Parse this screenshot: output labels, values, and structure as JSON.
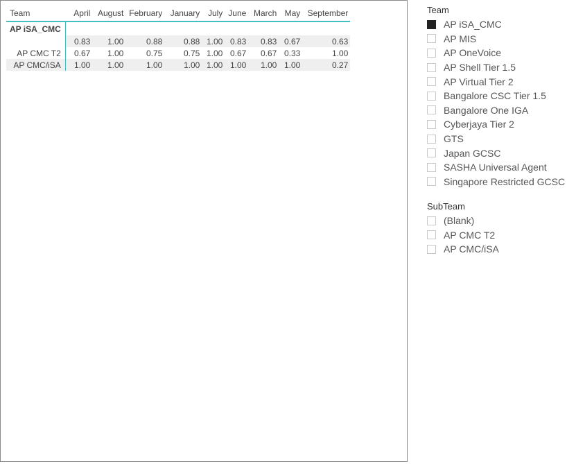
{
  "matrix": {
    "columns": [
      "Team",
      "April",
      "August",
      "February",
      "January",
      "July",
      "June",
      "March",
      "May",
      "September"
    ],
    "group": "AP iSA_CMC",
    "rows": [
      {
        "label": "",
        "values": [
          "0.83",
          "1.00",
          "0.88",
          "0.88",
          "1.00",
          "0.83",
          "0.83",
          "0.67",
          "0.63"
        ]
      },
      {
        "label": "AP CMC T2",
        "values": [
          "0.67",
          "1.00",
          "0.75",
          "0.75",
          "1.00",
          "0.67",
          "0.67",
          "0.33",
          "1.00"
        ]
      },
      {
        "label": "AP CMC/iSA",
        "values": [
          "1.00",
          "1.00",
          "1.00",
          "1.00",
          "1.00",
          "1.00",
          "1.00",
          "1.00",
          "0.27"
        ]
      }
    ]
  },
  "team_slicer": {
    "title": "Team",
    "items": [
      {
        "label": "AP iSA_CMC",
        "checked": true
      },
      {
        "label": "AP MIS",
        "checked": false
      },
      {
        "label": "AP OneVoice",
        "checked": false
      },
      {
        "label": "AP Shell Tier 1.5",
        "checked": false
      },
      {
        "label": "AP Virtual Tier 2",
        "checked": false
      },
      {
        "label": "Bangalore CSC Tier 1.5",
        "checked": false
      },
      {
        "label": "Bangalore One IGA",
        "checked": false
      },
      {
        "label": "Cyberjaya Tier 2",
        "checked": false
      },
      {
        "label": "GTS",
        "checked": false
      },
      {
        "label": "Japan GCSC",
        "checked": false
      },
      {
        "label": "SASHA Universal Agent",
        "checked": false
      },
      {
        "label": "Singapore Restricted GCSC",
        "checked": false
      }
    ]
  },
  "subteam_slicer": {
    "title": "SubTeam",
    "items": [
      {
        "label": "(Blank)",
        "checked": false
      },
      {
        "label": "AP CMC T2",
        "checked": false
      },
      {
        "label": "AP CMC/iSA",
        "checked": false
      }
    ]
  }
}
